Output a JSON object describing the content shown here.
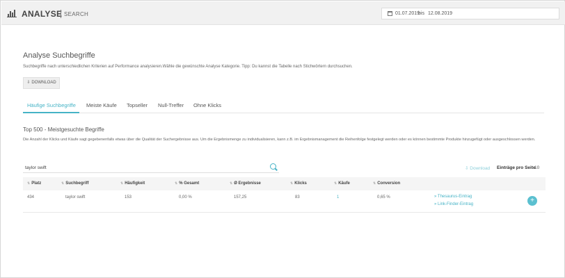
{
  "header": {
    "app_title": "ANALYSE",
    "app_subtitle": "SEARCH",
    "logo_icon": "bar-chart-icon",
    "date_range": {
      "icon": "calendar-icon",
      "from": "01.07.2019",
      "separator": "bis",
      "to": "12.08.2019"
    }
  },
  "page": {
    "title": "Analyse Suchbegriffe",
    "description": "Suchbegriffe nach unterschiedlichen Kriterien auf Performance analysieren.Wähle die gewünschte Analyse Kategorie. Tipp: Du kannst die Tabelle nach Stichwörtern durchsuchen.",
    "download_button": "DOWNLOAD"
  },
  "tabs": [
    {
      "label": "Häufige Suchbegriffe",
      "active": true
    },
    {
      "label": "Meiste Käufe",
      "active": false
    },
    {
      "label": "Topseller",
      "active": false
    },
    {
      "label": "Null-Treffer",
      "active": false
    },
    {
      "label": "Ohne Klicks",
      "active": false
    }
  ],
  "section": {
    "title": "Top 500 - Meistgesuchte Begriffe",
    "description": "Die Anzahl der Klicks und Käufe sagt gegebenenfalls etwas über die Qualität der Suchergebnisse aus. Um die Ergebnismenge zu individualisieren, kann z.B. im Ergebnismanagement die Reihenfolge festgelegt werden oder es können bestimmte Produkte hinzugefügt oder ausgeschlossen werden."
  },
  "search": {
    "value": "taylor swift",
    "icon": "search-icon"
  },
  "table_tools": {
    "download_link": "Download",
    "entries_label": "Einträge pro Seite",
    "entries_value": "10"
  },
  "table": {
    "columns": [
      "Platz",
      "Suchbegriff",
      "Häufigkeit",
      "% Gesamt",
      "Ø Ergebnisse",
      "Klicks",
      "Käufe",
      "Conversion"
    ],
    "rows": [
      {
        "platz": "434",
        "suchbegriff": "taylor swift",
        "haeufigkeit": "153",
        "gesamt": "0,00 %",
        "ergebnisse": "157,25",
        "klicks": "83",
        "kaeufe": "1",
        "conversion": "0,65 %",
        "links": [
          "Thesaurus-Eintrag",
          "Link-Finder-Eintrag"
        ]
      }
    ]
  },
  "colors": {
    "accent": "#46b3c6",
    "header_bg": "#f1f1f1"
  }
}
